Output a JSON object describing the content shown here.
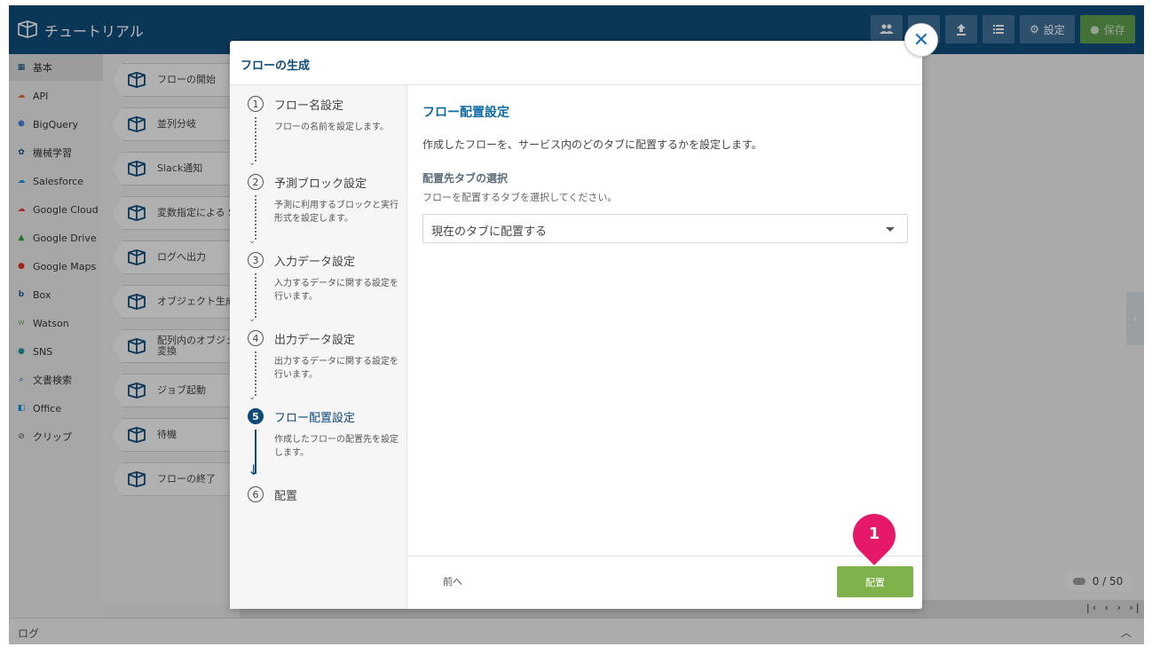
{
  "header": {
    "title": "チュートリアル",
    "settings_label": "設定",
    "save_label": "保存"
  },
  "categories": [
    {
      "label": "基本",
      "icon": "tutorial-icon"
    },
    {
      "label": "API",
      "icon": "api-icon"
    },
    {
      "label": "BigQuery",
      "icon": "bigquery-icon"
    },
    {
      "label": "機械学習",
      "icon": "brain-icon"
    },
    {
      "label": "Salesforce",
      "icon": "salesforce-icon"
    },
    {
      "label": "Google Cloud",
      "icon": "google-cloud-icon"
    },
    {
      "label": "Google Drive",
      "icon": "google-drive-icon"
    },
    {
      "label": "Google Maps",
      "icon": "map-pin-icon"
    },
    {
      "label": "Box",
      "icon": "box-icon"
    },
    {
      "label": "Watson",
      "icon": "watson-icon"
    },
    {
      "label": "SNS",
      "icon": "chat-icon"
    },
    {
      "label": "文書検索",
      "icon": "document-search-icon"
    },
    {
      "label": "Office",
      "icon": "office-icon"
    },
    {
      "label": "クリップ",
      "icon": "paperclip-icon"
    }
  ],
  "blocks": [
    {
      "label": "フローの開始"
    },
    {
      "label": "並列分岐"
    },
    {
      "label": "Slack通知"
    },
    {
      "label": "変数指定による S"
    },
    {
      "label": "ログへ出力"
    },
    {
      "label": "オブジェクト生成"
    },
    {
      "label": "配列内のオブジェ",
      "label2": "変換"
    },
    {
      "label": "ジョブ起動"
    },
    {
      "label": "待機"
    },
    {
      "label": "フローの終了"
    }
  ],
  "modal": {
    "title": "フローの生成",
    "steps": [
      {
        "num": "1",
        "title": "フロー名設定",
        "desc": "フローの名前を設定します。"
      },
      {
        "num": "2",
        "title": "予測ブロック設定",
        "desc": "予測に利用するブロックと実行形式を設定します。"
      },
      {
        "num": "3",
        "title": "入力データ設定",
        "desc": "入力するデータに関する設定を行います。"
      },
      {
        "num": "4",
        "title": "出力データ設定",
        "desc": "出力するデータに関する設定を行います。"
      },
      {
        "num": "5",
        "title": "フロー配置設定",
        "desc": "作成したフローの配置先を設定します。"
      },
      {
        "num": "6",
        "title": "配置",
        "desc": ""
      }
    ],
    "content": {
      "title": "フロー配置設定",
      "description": "作成したフローを、サービス内のどのタブに配置するかを設定します。",
      "select_label": "配置先タブの選択",
      "select_hint": "フローを配置するタブを選択してください。",
      "select_value": "現在のタブに配置する"
    },
    "prev_label": "前へ",
    "place_label": "配置"
  },
  "callout": {
    "number": "1",
    "color": "#e6186a"
  },
  "counter": {
    "value": "0 / 50"
  },
  "log_label": "ログ",
  "colors": {
    "header": "#0e4b7a",
    "accent": "#0e6aa5",
    "place_button": "#7fb24a",
    "save_button": "#5e9d4e"
  }
}
